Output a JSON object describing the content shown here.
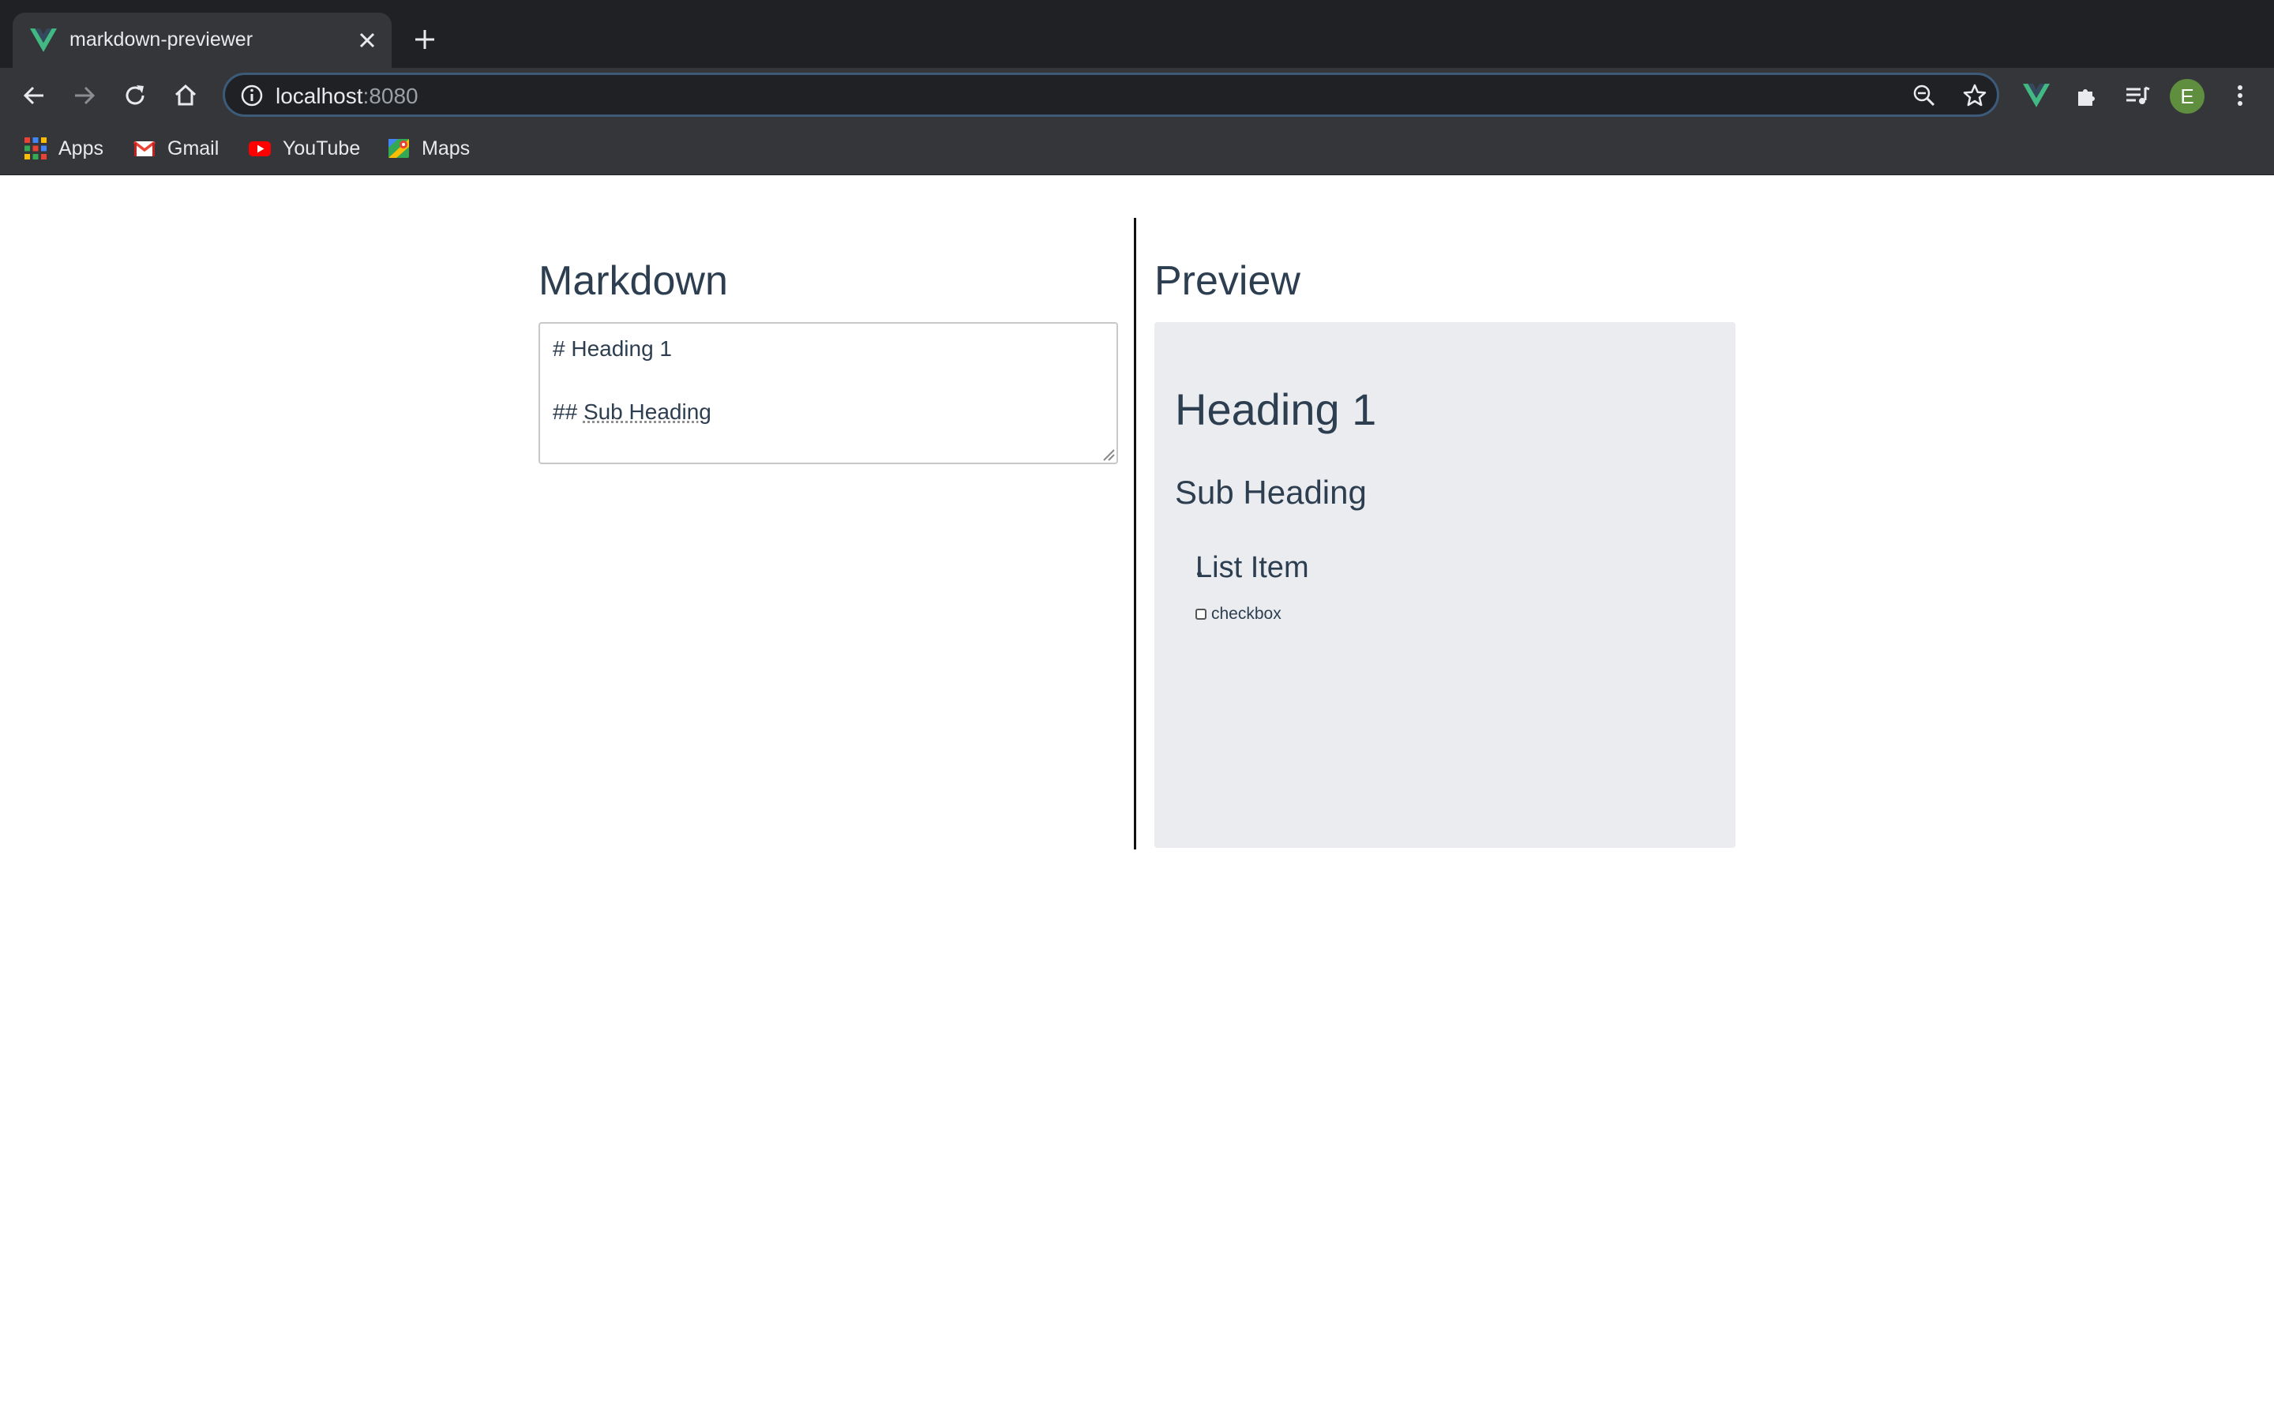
{
  "browser": {
    "tab": {
      "title": "markdown-previewer"
    },
    "url": {
      "host": "localhost",
      "port": ":8080"
    },
    "profile_initial": "E",
    "bookmarks": [
      {
        "label": "Apps",
        "icon": "apps-grid-icon"
      },
      {
        "label": "Gmail",
        "icon": "gmail-icon"
      },
      {
        "label": "YouTube",
        "icon": "youtube-icon"
      },
      {
        "label": "Maps",
        "icon": "maps-icon"
      }
    ]
  },
  "editor": {
    "title": "Markdown",
    "line1": "# Heading 1",
    "line2_prefix": "## ",
    "line2_word": "Sub Heading"
  },
  "preview": {
    "title": "Preview",
    "h1": "Heading 1",
    "h2": "Sub Heading",
    "list_item": "List Item",
    "checkbox_item": "checkbox"
  },
  "colors": {
    "chrome_dark": "#202124",
    "chrome_toolbar": "#35363a",
    "text_primary": "#2c3e50",
    "preview_bg": "#ebecef",
    "vue_green": "#42b883"
  }
}
